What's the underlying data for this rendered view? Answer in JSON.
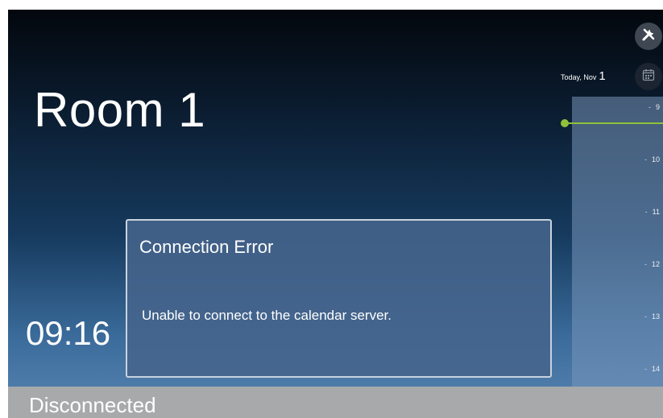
{
  "room": {
    "name": "Room 1"
  },
  "clock": {
    "time": "09:16"
  },
  "calendar": {
    "date_prefix": "Today, Nov",
    "date_day": "1",
    "hours": [
      "9",
      "10",
      "11",
      "12",
      "13",
      "14"
    ],
    "now_line_color": "#8fc23a"
  },
  "toolbar": {
    "tools_icon": "tools-icon",
    "calendar_icon": "calendar-icon"
  },
  "dialog": {
    "title": "Connection Error",
    "message": "Unable to connect to the calendar server."
  },
  "status": {
    "text": "Disconnected"
  },
  "colors": {
    "status_bar": "#a7a9ab",
    "accent_green": "#8fc23a"
  }
}
